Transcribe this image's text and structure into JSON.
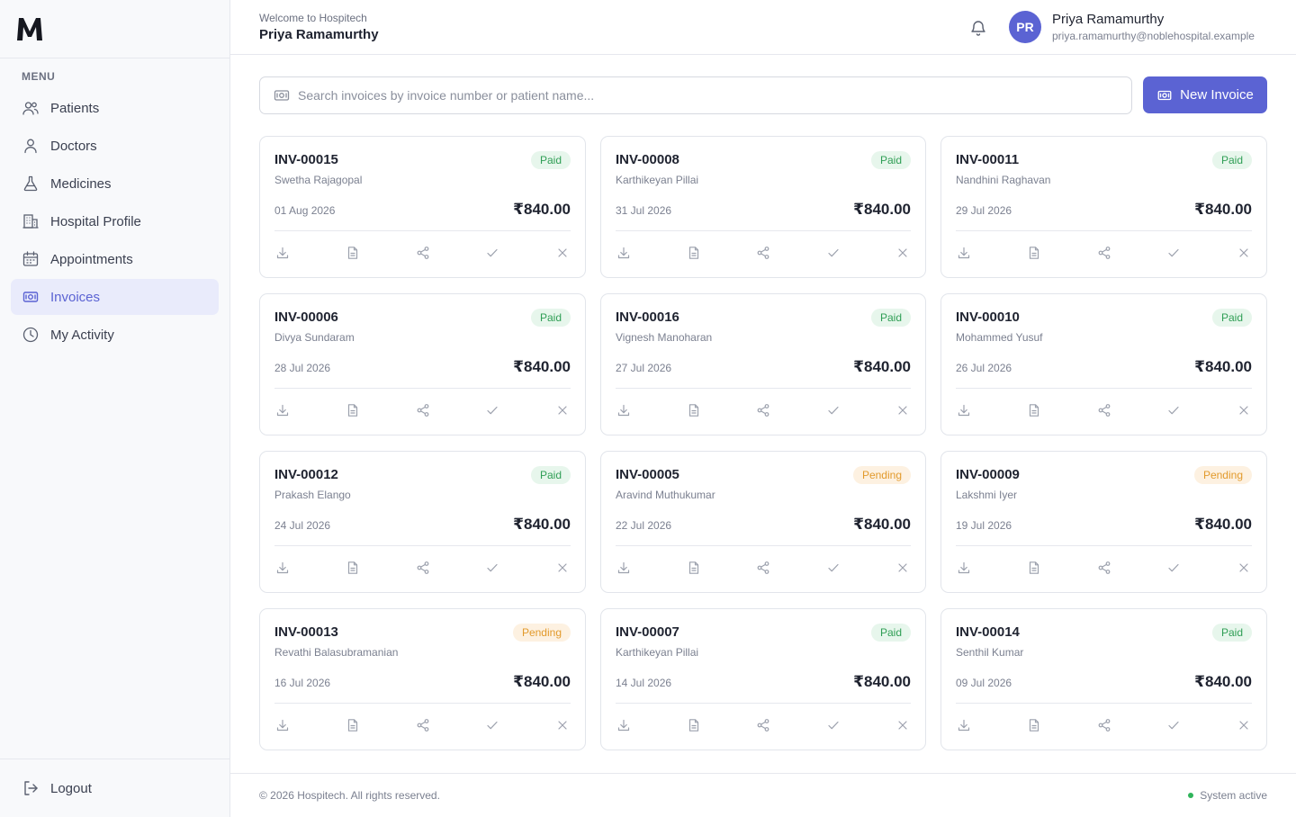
{
  "app": {
    "logo_letter": "M"
  },
  "sidebar": {
    "menu_label": "MENU",
    "items": [
      {
        "label": "Patients",
        "icon": "users-icon",
        "active": false
      },
      {
        "label": "Doctors",
        "icon": "user-icon",
        "active": false
      },
      {
        "label": "Medicines",
        "icon": "flask-icon",
        "active": false
      },
      {
        "label": "Hospital Profile",
        "icon": "building-icon",
        "active": false
      },
      {
        "label": "Appointments",
        "icon": "calendar-icon",
        "active": false
      },
      {
        "label": "Invoices",
        "icon": "banknote-icon",
        "active": true
      },
      {
        "label": "My Activity",
        "icon": "clock-icon",
        "active": false
      }
    ],
    "logout_label": "Logout"
  },
  "header": {
    "welcome": "Welcome to Hospitech",
    "name": "Priya Ramamurthy",
    "user": {
      "initials": "PR",
      "name": "Priya Ramamurthy",
      "email": "priya.ramamurthy@noblehospital.example"
    }
  },
  "search": {
    "placeholder": "Search invoices by invoice number or patient name...",
    "value": ""
  },
  "new_invoice_label": "New Invoice",
  "invoices": [
    {
      "number": "INV-00015",
      "patient": "Swetha Rajagopal",
      "date": "01 Aug 2026",
      "amount": "₹840.00",
      "status": "Paid"
    },
    {
      "number": "INV-00008",
      "patient": "Karthikeyan Pillai",
      "date": "31 Jul 2026",
      "amount": "₹840.00",
      "status": "Paid"
    },
    {
      "number": "INV-00011",
      "patient": "Nandhini Raghavan",
      "date": "29 Jul 2026",
      "amount": "₹840.00",
      "status": "Paid"
    },
    {
      "number": "INV-00006",
      "patient": "Divya Sundaram",
      "date": "28 Jul 2026",
      "amount": "₹840.00",
      "status": "Paid"
    },
    {
      "number": "INV-00016",
      "patient": "Vignesh Manoharan",
      "date": "27 Jul 2026",
      "amount": "₹840.00",
      "status": "Paid"
    },
    {
      "number": "INV-00010",
      "patient": "Mohammed Yusuf",
      "date": "26 Jul 2026",
      "amount": "₹840.00",
      "status": "Paid"
    },
    {
      "number": "INV-00012",
      "patient": "Prakash Elango",
      "date": "24 Jul 2026",
      "amount": "₹840.00",
      "status": "Paid"
    },
    {
      "number": "INV-00005",
      "patient": "Aravind Muthukumar",
      "date": "22 Jul 2026",
      "amount": "₹840.00",
      "status": "Pending"
    },
    {
      "number": "INV-00009",
      "patient": "Lakshmi Iyer",
      "date": "19 Jul 2026",
      "amount": "₹840.00",
      "status": "Pending"
    },
    {
      "number": "INV-00013",
      "patient": "Revathi Balasubramanian",
      "date": "16 Jul 2026",
      "amount": "₹840.00",
      "status": "Pending"
    },
    {
      "number": "INV-00007",
      "patient": "Karthikeyan Pillai",
      "date": "14 Jul 2026",
      "amount": "₹840.00",
      "status": "Paid"
    },
    {
      "number": "INV-00014",
      "patient": "Senthil Kumar",
      "date": "09 Jul 2026",
      "amount": "₹840.00",
      "status": "Paid"
    }
  ],
  "card_actions": [
    "download-icon",
    "file-icon",
    "share-icon",
    "check-icon",
    "close-icon"
  ],
  "footer": {
    "copyright": "© 2026 Hospitech. All rights reserved.",
    "status": "System active"
  },
  "colors": {
    "accent": "#5b63d3",
    "paid_bg": "#e7f6ec",
    "paid_text": "#2f9e55",
    "pending_bg": "#fdf1e1",
    "pending_text": "#e29a2c",
    "active_dot": "#2fb45a"
  }
}
